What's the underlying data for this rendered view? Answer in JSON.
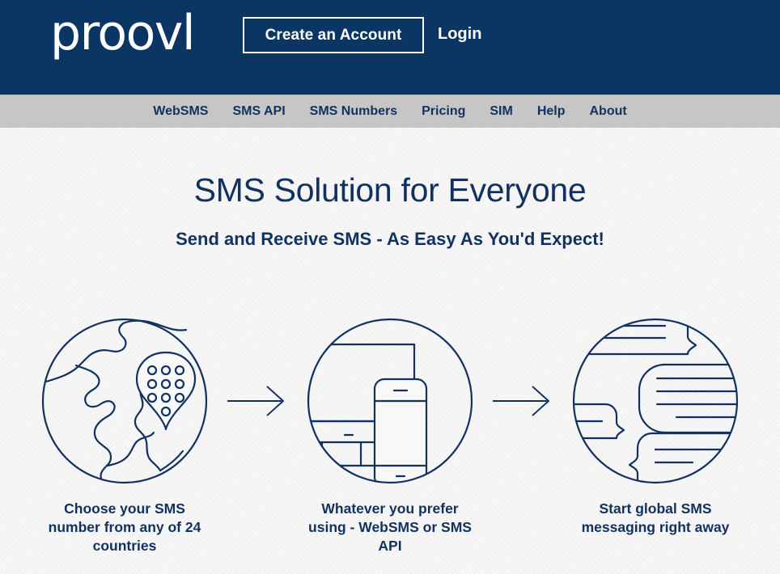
{
  "brand": {
    "logo_text": "proovl",
    "primary_navy": "#0b3563",
    "text_navy": "#12315f",
    "nav_gray": "#c6c6c6",
    "page_bg": "#f7f7f7"
  },
  "topbar": {
    "create_account_label": "Create an Account",
    "login_label": "Login"
  },
  "nav": {
    "items": [
      {
        "label": "WebSMS"
      },
      {
        "label": "SMS API"
      },
      {
        "label": "SMS Numbers"
      },
      {
        "label": "Pricing"
      },
      {
        "label": "SIM"
      },
      {
        "label": "Help"
      },
      {
        "label": "About"
      }
    ]
  },
  "hero": {
    "title": "SMS Solution for Everyone",
    "subtitle": "Send and Receive SMS - As Easy As You'd Expect!"
  },
  "steps": [
    {
      "icon": "globe-pin-icon",
      "caption": "Choose your SMS number from any of 24 countries"
    },
    {
      "icon": "desktop-phone-icon",
      "caption": "Whatever you prefer using - WebSMS or SMS API"
    },
    {
      "icon": "speech-bubbles-icon",
      "caption": "Start global SMS messaging right away"
    }
  ],
  "separators": {
    "arrow_1": "arrow-right-icon",
    "arrow_2": "arrow-right-icon"
  }
}
